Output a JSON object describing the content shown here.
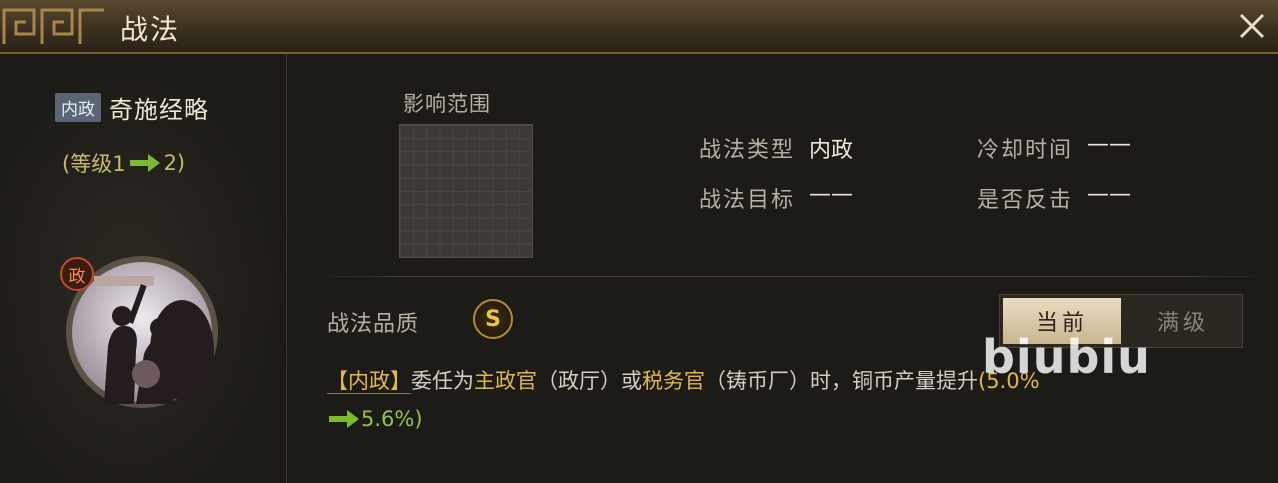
{
  "title": "战法",
  "skill": {
    "category": "内政",
    "name": "奇施经略",
    "level_prefix": "(等级1",
    "level_suffix": "2)",
    "portrait_badge": "政"
  },
  "range_label": "影响范围",
  "attributes": {
    "type_label": "战法类型",
    "type_value": "内政",
    "cooldown_label": "冷却时间",
    "cooldown_value": "——",
    "target_label": "战法目标",
    "target_value": "——",
    "counter_label": "是否反击",
    "counter_value": "——"
  },
  "quality": {
    "label": "战法品质",
    "grade": "S"
  },
  "toggle": {
    "current": "当前",
    "max": "满级"
  },
  "description": {
    "tag": "【内政】",
    "p1": "委任为",
    "role1": "主政官",
    "p2": "（政厅）或",
    "role2": "税务官",
    "p3": "（铸币厂）时，铜币产量提升",
    "value_from": "(5.0%",
    "value_to": "5.6%)"
  },
  "watermark": "biubiu",
  "colors": {
    "accent_gold": "#e0b84b",
    "arrow_green": "#8fc34a",
    "title_bar": "#3b3020"
  }
}
